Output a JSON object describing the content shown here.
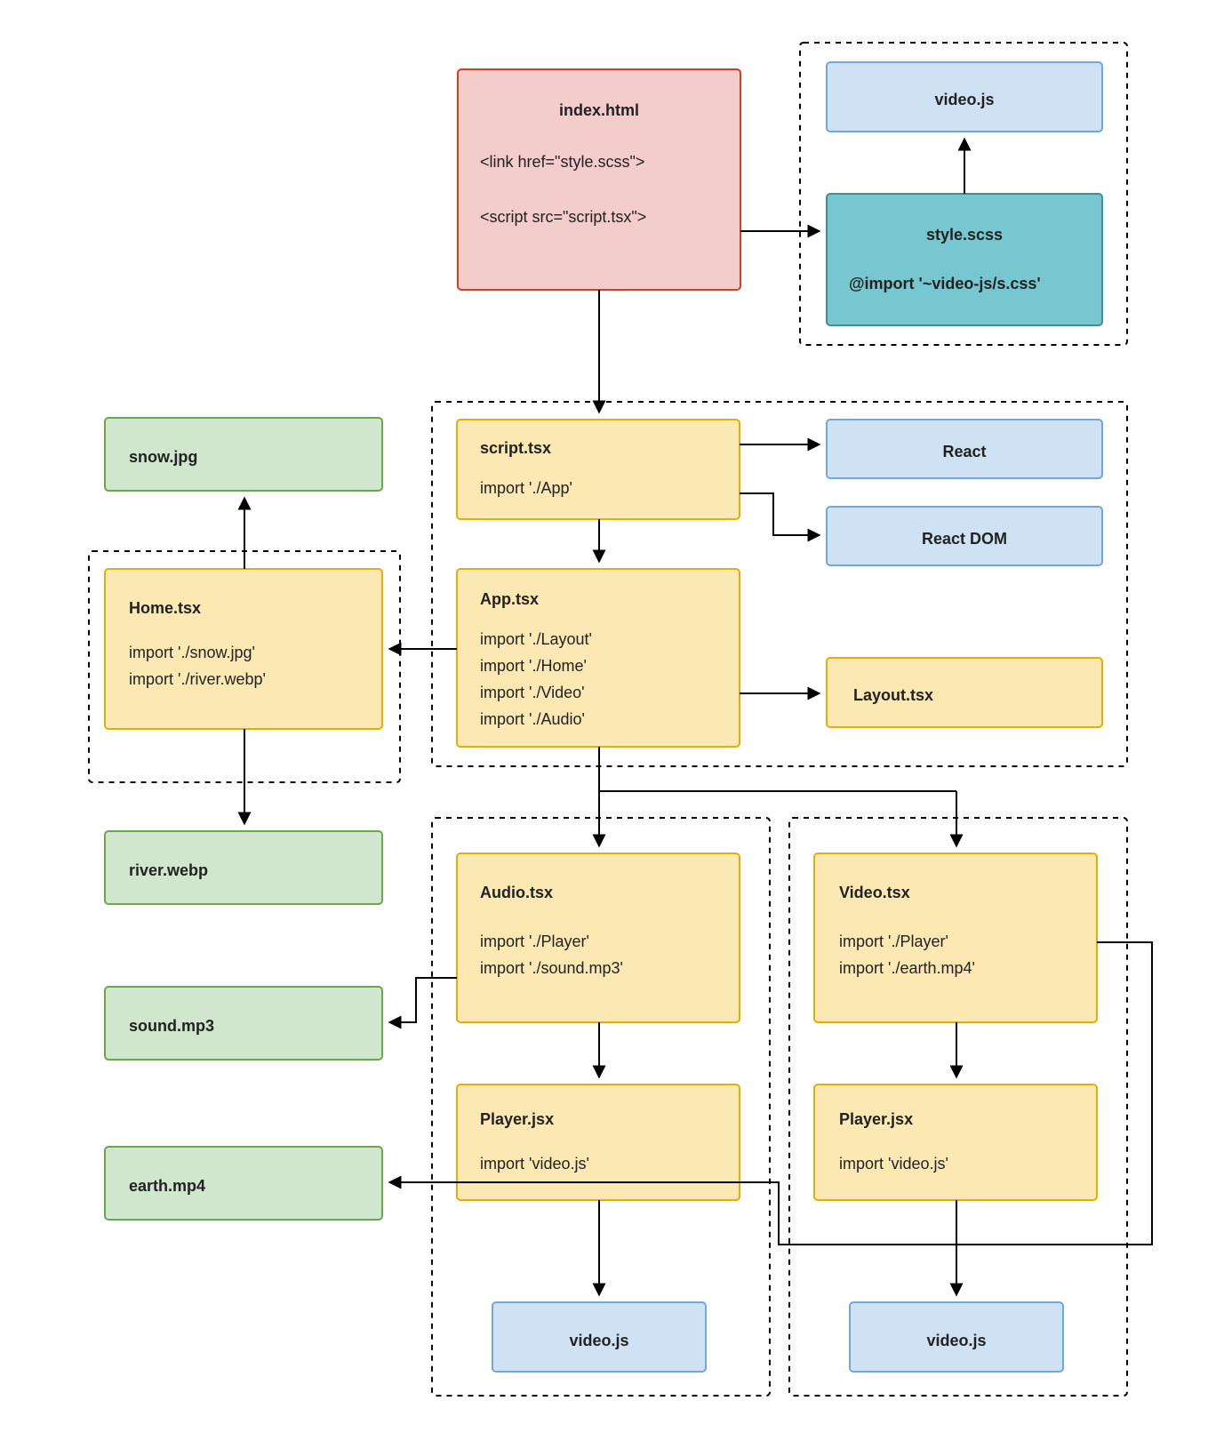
{
  "nodes": {
    "index": {
      "title": "index.html",
      "lines": [
        "<link href=\"style.scss\">",
        "<script src=\"script.tsx\">"
      ]
    },
    "style": {
      "title": "style.scss",
      "lines": [
        "@import '~video-js/s.css'"
      ]
    },
    "videojs_top": {
      "title": "video.js"
    },
    "script": {
      "title": "script.tsx",
      "lines": [
        "import './App'"
      ]
    },
    "react": {
      "title": "React"
    },
    "reactdom": {
      "title": "React DOM"
    },
    "app": {
      "title": "App.tsx",
      "lines": [
        "import './Layout'",
        "import './Home'",
        "import './Video'",
        "import './Audio'"
      ]
    },
    "layout": {
      "title": "Layout.tsx"
    },
    "home": {
      "title": "Home.tsx",
      "lines": [
        "import './snow.jpg'",
        "import './river.webp'"
      ]
    },
    "snow": {
      "title": "snow.jpg"
    },
    "river": {
      "title": "river.webp"
    },
    "sound": {
      "title": "sound.mp3"
    },
    "earth": {
      "title": "earth.mp4"
    },
    "audio": {
      "title": "Audio.tsx",
      "lines": [
        "import './Player'",
        "import './sound.mp3'"
      ]
    },
    "video": {
      "title": "Video.tsx",
      "lines": [
        "import './Player'",
        "import './earth.mp4'"
      ]
    },
    "player_a": {
      "title": "Player.jsx",
      "lines": [
        "import 'video.js'"
      ]
    },
    "player_v": {
      "title": "Player.jsx",
      "lines": [
        "import 'video.js'"
      ]
    },
    "videojs_a": {
      "title": "video.js"
    },
    "videojs_v": {
      "title": "video.js"
    }
  }
}
